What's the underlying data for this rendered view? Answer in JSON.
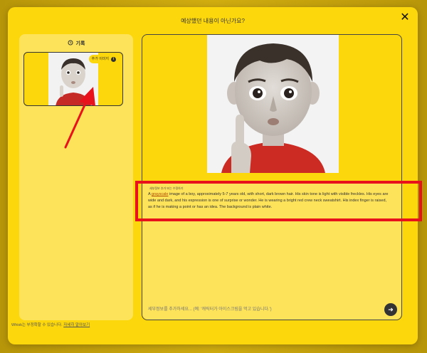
{
  "modal": {
    "title": "예상했던 내용이 아닌가요?",
    "close": "✕"
  },
  "history": {
    "header": "기록",
    "header_icon": "history-icon",
    "thumb_badge": "추가 이미지",
    "thumb_info": "i"
  },
  "description": {
    "label": "세부정보 추가 또는 수정하기",
    "text_before": "A ",
    "text_underlined": "grayscale",
    "text_after": " image of a boy, approximately 5-7 years old, with short, dark brown hair. His skin tone is light with visible freckles. His eyes are wide and dark, and his expression is one of surprise or wonder. He is wearing a bright red crew neck sweatshirt. His index finger is raised, as if he is making a point or has an idea. The background is plain white."
  },
  "input": {
    "placeholder": "세부정보를 추가하세요... (예: '캐릭터가 아이스크림을 먹고 있습니다.')"
  },
  "send_button": "➜",
  "footer": {
    "text": "Whisk는 부정확할 수 있습니다.",
    "link": "자세히 알아보기"
  },
  "colors": {
    "modal_bg": "#fcd70b",
    "panel_bg": "#fde35a",
    "annotation_red": "#e8121d"
  }
}
